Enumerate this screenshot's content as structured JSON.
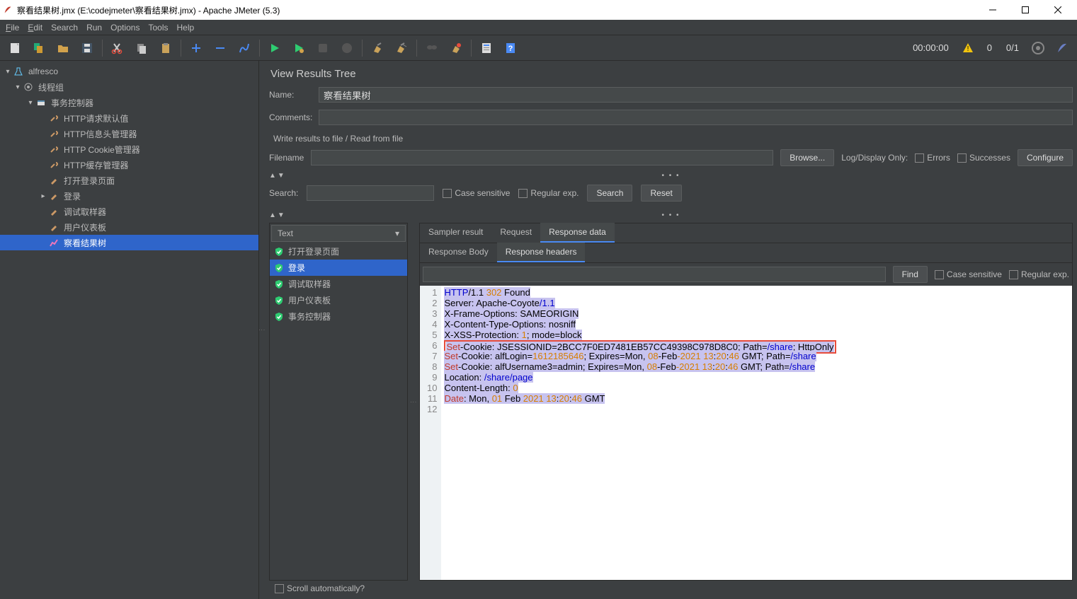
{
  "titlebar": {
    "title": "察看结果树.jmx (E:\\codejmeter\\察看结果树.jmx) - Apache JMeter (5.3)"
  },
  "menu": {
    "file": "File",
    "edit": "Edit",
    "search": "Search",
    "run": "Run",
    "options": "Options",
    "tools": "Tools",
    "help": "Help"
  },
  "toolbar_status": {
    "time": "00:00:00",
    "warn_count": "0",
    "thread_ratio": "0/1"
  },
  "tree": {
    "root": "alfresco",
    "tg": "线程组",
    "tc": "事务控制器",
    "items": [
      "HTTP请求默认值",
      "HTTP信息头管理器",
      "HTTP Cookie管理器",
      "HTTP缓存管理器",
      "打开登录页面",
      "登录",
      "调试取样器",
      "用户仪表板",
      "察看结果树"
    ]
  },
  "panel": {
    "title": "View Results Tree",
    "name_label": "Name:",
    "name_value": "察看结果树",
    "comments_label": "Comments:",
    "write_label": "Write results to file / Read from file",
    "filename_label": "Filename",
    "browse": "Browse...",
    "logdisplay": "Log/Display Only:",
    "errors": "Errors",
    "successes": "Successes",
    "configure": "Configure",
    "search_label": "Search:",
    "case_sensitive": "Case sensitive",
    "regex": "Regular exp.",
    "search_btn": "Search",
    "reset_btn": "Reset",
    "renderer": "Text",
    "samplers": [
      "打开登录页面",
      "登录",
      "调试取样器",
      "用户仪表板",
      "事务控制器"
    ],
    "sampler_selected": 1,
    "tabs1": [
      "Sampler result",
      "Request",
      "Response data"
    ],
    "tabs1_active": 2,
    "tabs2": [
      "Response Body",
      "Response headers"
    ],
    "tabs2_active": 1,
    "find": "Find",
    "case_sensitive2": "Case sensitive",
    "regex2": "Regular exp.",
    "scroll_auto": "Scroll automatically?"
  },
  "response_lines": [
    [
      {
        "t": "HTTP",
        "c": "kw-blue"
      },
      {
        "t": "/1.1 ",
        "c": ""
      },
      {
        "t": "302",
        "c": "kw-orange"
      },
      {
        "t": " Found",
        "c": ""
      }
    ],
    [
      {
        "t": "Server: Apache-Coyote",
        "c": ""
      },
      {
        "t": "/1.1",
        "c": "kw-blue"
      }
    ],
    [
      {
        "t": "X-Frame-Options: SAMEORIGIN",
        "c": ""
      }
    ],
    [
      {
        "t": "X-Content-Type-Options: nosniff",
        "c": ""
      }
    ],
    [
      {
        "t": "X-XSS-Protection: ",
        "c": ""
      },
      {
        "t": "1",
        "c": "kw-orange"
      },
      {
        "t": "; mode=block",
        "c": ""
      }
    ],
    [
      {
        "t": "Set",
        "c": "kw-red"
      },
      {
        "t": "-Cookie: JSESSIONID=2BCC7F0ED7481EB57CC49398C978D8C0; Path=",
        "c": ""
      },
      {
        "t": "/share",
        "c": "kw-blue"
      },
      {
        "t": "; HttpOnly",
        "c": ""
      }
    ],
    [
      {
        "t": "Set",
        "c": "kw-red"
      },
      {
        "t": "-Cookie: alfLogin=",
        "c": ""
      },
      {
        "t": "1612185646",
        "c": "kw-orange"
      },
      {
        "t": "; Expires=Mon, ",
        "c": ""
      },
      {
        "t": "08",
        "c": "kw-orange"
      },
      {
        "t": "-Feb",
        "c": ""
      },
      {
        "t": "-2021 13",
        "c": "kw-orange"
      },
      {
        "t": ":",
        "c": ""
      },
      {
        "t": "20",
        "c": "kw-orange"
      },
      {
        "t": ":",
        "c": ""
      },
      {
        "t": "46",
        "c": "kw-orange"
      },
      {
        "t": " GMT; Path=",
        "c": ""
      },
      {
        "t": "/share",
        "c": "kw-blue"
      }
    ],
    [
      {
        "t": "Set",
        "c": "kw-red"
      },
      {
        "t": "-Cookie: alfUsername3=admin; Expires=Mon, ",
        "c": ""
      },
      {
        "t": "08",
        "c": "kw-orange"
      },
      {
        "t": "-Feb",
        "c": ""
      },
      {
        "t": "-2021 13",
        "c": "kw-orange"
      },
      {
        "t": ":",
        "c": ""
      },
      {
        "t": "20",
        "c": "kw-orange"
      },
      {
        "t": ":",
        "c": ""
      },
      {
        "t": "46",
        "c": "kw-orange"
      },
      {
        "t": " GMT; Path=",
        "c": ""
      },
      {
        "t": "/share",
        "c": "kw-blue"
      }
    ],
    [
      {
        "t": "Location: ",
        "c": ""
      },
      {
        "t": "/share/page",
        "c": "kw-blue"
      }
    ],
    [
      {
        "t": "Content-Length: ",
        "c": ""
      },
      {
        "t": "0",
        "c": "kw-orange"
      }
    ],
    [
      {
        "t": "Date",
        "c": "kw-red"
      },
      {
        "t": ": Mon, ",
        "c": ""
      },
      {
        "t": "01",
        "c": "kw-orange"
      },
      {
        "t": " Feb ",
        "c": ""
      },
      {
        "t": "2021 13",
        "c": "kw-orange"
      },
      {
        "t": ":",
        "c": ""
      },
      {
        "t": "20",
        "c": "kw-orange"
      },
      {
        "t": ":",
        "c": ""
      },
      {
        "t": "46",
        "c": "kw-orange"
      },
      {
        "t": " GMT",
        "c": ""
      }
    ],
    []
  ],
  "highlight_line": 5
}
